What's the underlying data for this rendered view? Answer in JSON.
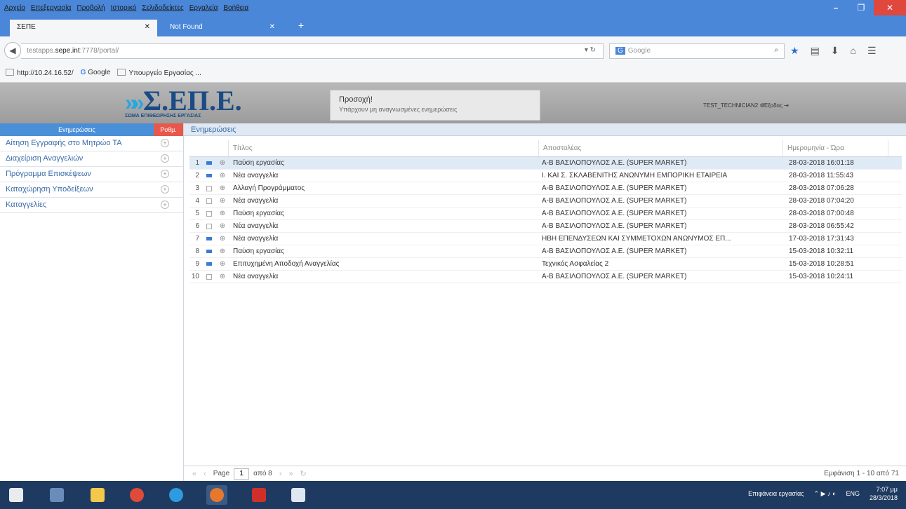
{
  "browser": {
    "menu": [
      "Αρχείο",
      "Επεξεργασία",
      "Προβολή",
      "Ιστορικό",
      "Σελιδοδείκτες",
      "Εργαλεία",
      "Βοήθεια"
    ],
    "tabs": [
      {
        "title": "ΣΕΠΕ",
        "active": true
      },
      {
        "title": "Not Found",
        "active": false
      }
    ],
    "url": {
      "prefix": "testapps.",
      "host": "sepe.int",
      "rest": ":7778/portal/"
    },
    "search_placeholder": "Google",
    "bookmarks": [
      "http://10.24.16.52/",
      "Google",
      "Υπουργείο Εργασίας ..."
    ]
  },
  "app": {
    "logo": {
      "brand": "Σ.ΕΠ.Ε.",
      "tagline": "ΣΩΜΑ ΕΠΙΘΕΩΡΗΣΗΣ ΕΡΓΑΣΙΑΣ"
    },
    "notice": {
      "title": "Προσοχή!",
      "message": "Υπάρχουν μη αναγνωσμένες ενημερώσεις"
    },
    "user": "TEST_TECHNICIAN2",
    "logout": "Έξοδος"
  },
  "sidebar": {
    "header_label": "Ενημερώσεις",
    "header_badge": "Ρυθμ.",
    "items": [
      "Αίτηση Εγγραφής στο Μητρώο ΤΑ",
      "Διαχείριση Αναγγελιών",
      "Πρόγραμμα Επισκέψεων",
      "Καταχώρηση Υποδείξεων",
      "Καταγγελίες"
    ]
  },
  "main": {
    "panel_title": "Ενημερώσεις",
    "columns": {
      "title": "Τίτλος",
      "sender": "Αποστολέας",
      "date": "Ημερομηνία - Ώρα"
    },
    "rows": [
      {
        "num": "1",
        "unread": true,
        "title": "Παύση εργασίας",
        "sender": "Α-Β ΒΑΣΙΛΟΠΟΥΛΟΣ Α.Ε. (SUPER MARKET)",
        "date": "28-03-2018 16:01:18"
      },
      {
        "num": "2",
        "unread": true,
        "title": "Νέα αναγγελία",
        "sender": "Ι. ΚΑΙ Σ. ΣΚΛΑΒΕΝΙΤΗΣ ΑΝΩΝΥΜΗ ΕΜΠΟΡΙΚΗ ΕΤΑΙΡΕΙΑ",
        "date": "28-03-2018 11:55:43"
      },
      {
        "num": "3",
        "unread": false,
        "title": "Αλλαγή Προγράμματος",
        "sender": "Α-Β ΒΑΣΙΛΟΠΟΥΛΟΣ Α.Ε. (SUPER MARKET)",
        "date": "28-03-2018 07:06:28"
      },
      {
        "num": "4",
        "unread": false,
        "title": "Νέα αναγγελία",
        "sender": "Α-Β ΒΑΣΙΛΟΠΟΥΛΟΣ Α.Ε. (SUPER MARKET)",
        "date": "28-03-2018 07:04:20"
      },
      {
        "num": "5",
        "unread": false,
        "title": "Παύση εργασίας",
        "sender": "Α-Β ΒΑΣΙΛΟΠΟΥΛΟΣ Α.Ε. (SUPER MARKET)",
        "date": "28-03-2018 07:00:48"
      },
      {
        "num": "6",
        "unread": false,
        "title": "Νέα αναγγελία",
        "sender": "Α-Β ΒΑΣΙΛΟΠΟΥΛΟΣ Α.Ε. (SUPER MARKET)",
        "date": "28-03-2018 06:55:42"
      },
      {
        "num": "7",
        "unread": true,
        "title": "Νέα αναγγελία",
        "sender": "ΗΒΗ ΕΠΕΝΔΥΣΕΩΝ ΚΑΙ ΣΥΜΜΕΤΟΧΩΝ ΑΝΩΝΥΜΟΣ ΕΠ...",
        "date": "17-03-2018 17:31:43"
      },
      {
        "num": "8",
        "unread": true,
        "title": "Παύση εργασίας",
        "sender": "Α-Β ΒΑΣΙΛΟΠΟΥΛΟΣ Α.Ε. (SUPER MARKET)",
        "date": "15-03-2018 10:32:11"
      },
      {
        "num": "9",
        "unread": true,
        "title": "Επιτυχημένη Αποδοχή Αναγγελίας",
        "sender": "Τεχνικός Ασφαλείας 2",
        "date": "15-03-2018 10:28:51"
      },
      {
        "num": "10",
        "unread": false,
        "title": "Νέα αναγγελία",
        "sender": "Α-Β ΒΑΣΙΛΟΠΟΥΛΟΣ Α.Ε. (SUPER MARKET)",
        "date": "15-03-2018 10:24:11"
      }
    ],
    "pager": {
      "page_label": "Page",
      "page": "1",
      "of_label": "από 8",
      "display": "Εμφάνιση 1 - 10 από 71"
    }
  },
  "taskbar": {
    "tray_text": "Επιφάνεια εργασίας",
    "lang": "ENG",
    "time": "7:07 μμ",
    "date": "28/3/2018"
  }
}
